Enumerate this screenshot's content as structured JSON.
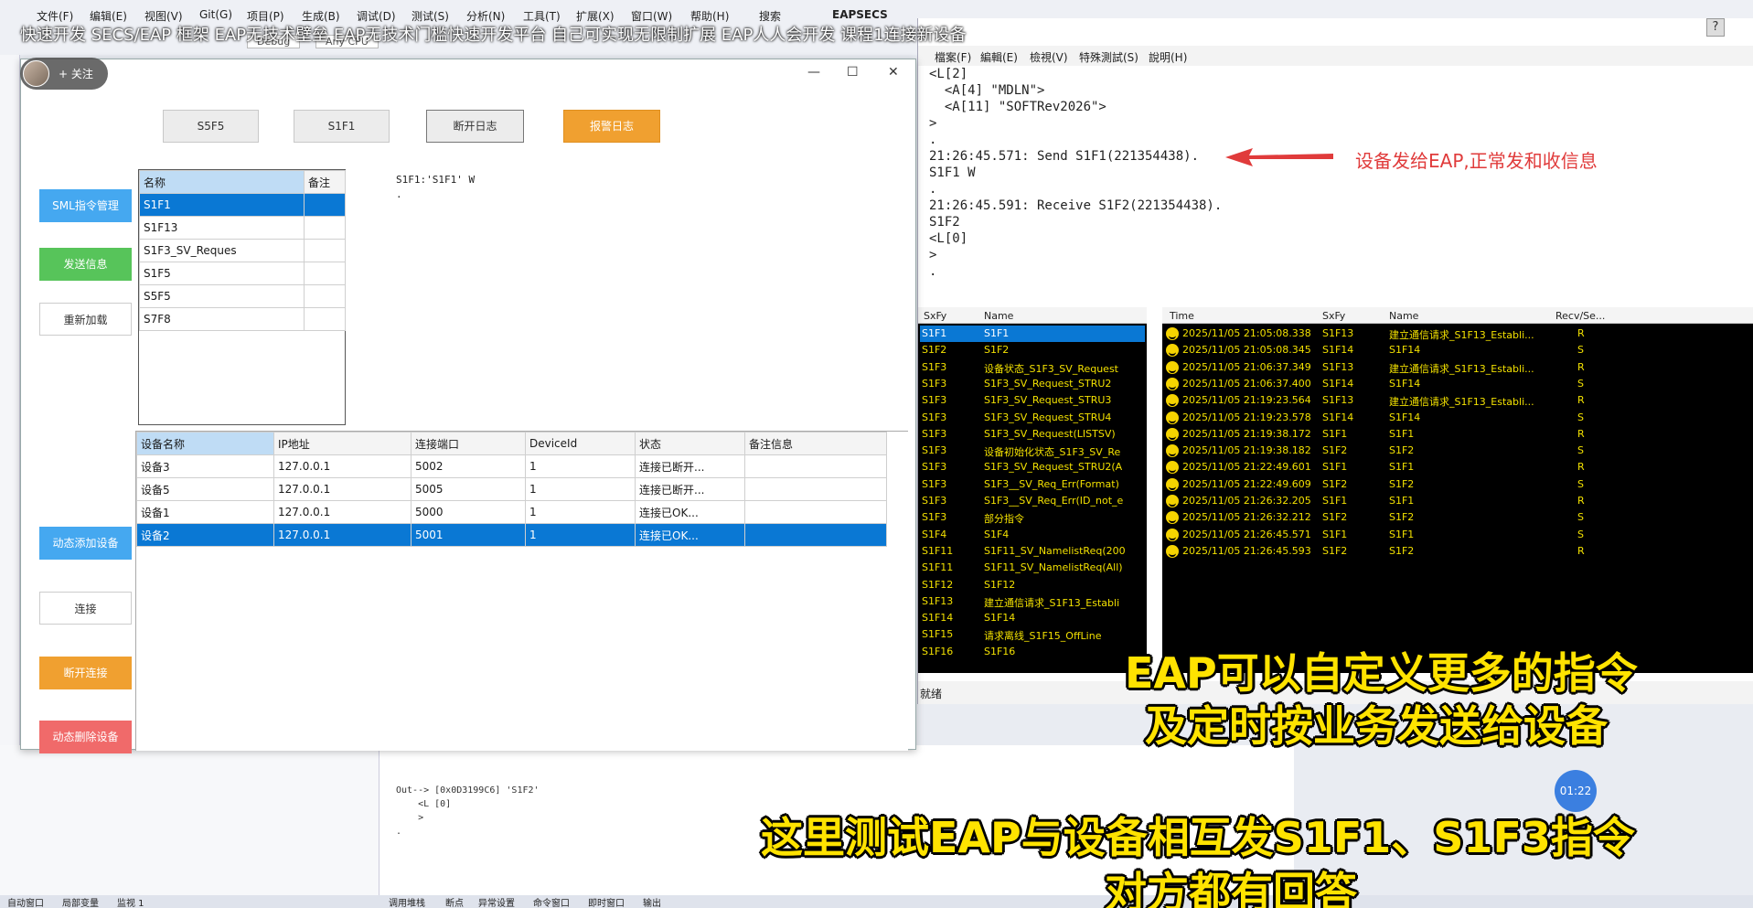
{
  "vs": {
    "menu": [
      "文件(F)",
      "编辑(E)",
      "视图(V)",
      "Git(G)",
      "项目(P)",
      "生成(B)",
      "调试(D)",
      "测试(S)",
      "分析(N)",
      "工具(T)",
      "扩展(X)",
      "窗口(W)",
      "帮助(H)"
    ],
    "search_label": "搜索",
    "app_name": "EAPSECS",
    "toolbar_debug": "Debug",
    "toolbar_cpu": "Any CPU",
    "output_lines": "Out--> [0x0D3199C6] 'S1F2'\n    <L [0]\n    >\n.",
    "status_tabs": [
      "自动窗口",
      "局部变量",
      "监视 1",
      "调用堆栈",
      "断点",
      "异常设置",
      "命令窗口",
      "即时窗口",
      "输出"
    ]
  },
  "video": {
    "title": "快速开发 SECS/EAP 框架 EAP无技术壁垒 EAP无技术门槛快速开发平台 自己可实现无限制扩展 EAP人人会开发 课程1连接新设备",
    "follow_label": "+ 关注",
    "help": "?",
    "timer": "01:22"
  },
  "eap": {
    "window_controls": [
      "—",
      "☐",
      "✕"
    ],
    "top_buttons": [
      {
        "label": "S5F5",
        "color": "#ececec"
      },
      {
        "label": "S1F1",
        "color": "#ececec"
      },
      {
        "label": "断开日志",
        "color": "#ececec"
      },
      {
        "label": "报警日志",
        "color": "#f0a030"
      }
    ],
    "side_buttons": [
      {
        "label": "SML指令管理",
        "color": "#45a8f0"
      },
      {
        "label": "发送信息",
        "color": "#57c45a"
      },
      {
        "label": "重新加载",
        "color": "#ffffff"
      },
      {
        "label": "动态添加设备",
        "color": "#45a8f0"
      },
      {
        "label": "连接",
        "color": "#ffffff"
      },
      {
        "label": "断开连接",
        "color": "#f0a030"
      },
      {
        "label": "动态删除设备",
        "color": "#f06a6a"
      }
    ],
    "cmd_grid": {
      "headers": [
        "名称",
        "备注"
      ],
      "rows": [
        {
          "name": "S1F1",
          "note": ""
        },
        {
          "name": "S1F13",
          "note": ""
        },
        {
          "name": "S1F3_SV_Reques",
          "note": ""
        },
        {
          "name": "S1F5",
          "note": ""
        },
        {
          "name": "S5F5",
          "note": ""
        },
        {
          "name": "S7F8",
          "note": ""
        }
      ]
    },
    "cmd_text": "S1F1:'S1F1' W\n.",
    "device_grid": {
      "headers": [
        "设备名称",
        "IP地址",
        "连接端口",
        "DeviceId",
        "状态",
        "备注信息"
      ],
      "rows": [
        {
          "name": "设备3",
          "ip": "127.0.0.1",
          "port": "5002",
          "id": "1",
          "status": "连接已断开...",
          "note": ""
        },
        {
          "name": "设备5",
          "ip": "127.0.0.1",
          "port": "5005",
          "id": "1",
          "status": "连接已断开...",
          "note": ""
        },
        {
          "name": "设备1",
          "ip": "127.0.0.1",
          "port": "5000",
          "id": "1",
          "status": "连接已OK...",
          "note": ""
        },
        {
          "name": "设备2",
          "ip": "127.0.0.1",
          "port": "5001",
          "id": "1",
          "status": "连接已OK...",
          "note": ""
        }
      ]
    }
  },
  "secs": {
    "menu": [
      "檔案(F)",
      "編輯(E)",
      "檢視(V)",
      "特殊測試(S)",
      "說明(H)"
    ],
    "log_text": "<L[2]\n  <A[4] \"MDLN\">\n  <A[11] \"SOFTRev2026\">\n>\n.\n21:26:45.571: Send S1F1(221354438).\nS1F1 W\n.\n21:26:45.591: Receive S1F2(221354438).\nS1F2\n<L[0]\n>\n.",
    "msg_headers": [
      "SxFy",
      "Name"
    ],
    "messages": [
      {
        "sxfy": "S1F1",
        "name": "S1F1"
      },
      {
        "sxfy": "S1F2",
        "name": "S1F2"
      },
      {
        "sxfy": "S1F3",
        "name": "设备状态_S1F3_SV_Request"
      },
      {
        "sxfy": "S1F3",
        "name": "S1F3_SV_Request_STRU2"
      },
      {
        "sxfy": "S1F3",
        "name": "S1F3_SV_Request_STRU3"
      },
      {
        "sxfy": "S1F3",
        "name": "S1F3_SV_Request_STRU4"
      },
      {
        "sxfy": "S1F3",
        "name": "S1F3_SV_Request(LISTSV)"
      },
      {
        "sxfy": "S1F3",
        "name": "设备初始化状态_S1F3_SV_Re"
      },
      {
        "sxfy": "S1F3",
        "name": "S1F3_SV_Request_STRU2(A"
      },
      {
        "sxfy": "S1F3",
        "name": "S1F3__SV_Req_Err(Format)"
      },
      {
        "sxfy": "S1F3",
        "name": "S1F3__SV_Req_Err(ID_not_e"
      },
      {
        "sxfy": "S1F3",
        "name": "部分指令"
      },
      {
        "sxfy": "S1F4",
        "name": "S1F4"
      },
      {
        "sxfy": "S1F11",
        "name": "S1F11_SV_NamelistReq(200"
      },
      {
        "sxfy": "S1F11",
        "name": "S1F11_SV_NamelistReq(All)"
      },
      {
        "sxfy": "S1F12",
        "name": "S1F12"
      },
      {
        "sxfy": "S1F13",
        "name": "建立通信请求_S1F13_Establi"
      },
      {
        "sxfy": "S1F14",
        "name": "S1F14"
      },
      {
        "sxfy": "S1F15",
        "name": "请求离线_S1F15_OffLine"
      },
      {
        "sxfy": "S1F16",
        "name": "S1F16"
      }
    ],
    "log_headers": [
      "Time",
      "SxFy",
      "Name",
      "Recv/Se..."
    ],
    "logs": [
      {
        "time": "2025/11/05 21:05:08.338",
        "sxfy": "S1F13",
        "name": "建立通信请求_S1F13_Establi...",
        "rs": "R"
      },
      {
        "time": "2025/11/05 21:05:08.345",
        "sxfy": "S1F14",
        "name": "S1F14",
        "rs": "S"
      },
      {
        "time": "2025/11/05 21:06:37.349",
        "sxfy": "S1F13",
        "name": "建立通信请求_S1F13_Establi...",
        "rs": "R"
      },
      {
        "time": "2025/11/05 21:06:37.400",
        "sxfy": "S1F14",
        "name": "S1F14",
        "rs": "S"
      },
      {
        "time": "2025/11/05 21:19:23.564",
        "sxfy": "S1F13",
        "name": "建立通信请求_S1F13_Establi...",
        "rs": "R"
      },
      {
        "time": "2025/11/05 21:19:23.578",
        "sxfy": "S1F14",
        "name": "S1F14",
        "rs": "S"
      },
      {
        "time": "2025/11/05 21:19:38.172",
        "sxfy": "S1F1",
        "name": "S1F1",
        "rs": "R"
      },
      {
        "time": "2025/11/05 21:19:38.182",
        "sxfy": "S1F2",
        "name": "S1F2",
        "rs": "S"
      },
      {
        "time": "2025/11/05 21:22:49.601",
        "sxfy": "S1F1",
        "name": "S1F1",
        "rs": "R"
      },
      {
        "time": "2025/11/05 21:22:49.609",
        "sxfy": "S1F2",
        "name": "S1F2",
        "rs": "S"
      },
      {
        "time": "2025/11/05 21:26:32.205",
        "sxfy": "S1F1",
        "name": "S1F1",
        "rs": "R"
      },
      {
        "time": "2025/11/05 21:26:32.212",
        "sxfy": "S1F2",
        "name": "S1F2",
        "rs": "S"
      },
      {
        "time": "2025/11/05 21:26:45.571",
        "sxfy": "S1F1",
        "name": "S1F1",
        "rs": "S"
      },
      {
        "time": "2025/11/05 21:26:45.593",
        "sxfy": "S1F2",
        "name": "S1F2",
        "rs": "R"
      }
    ],
    "status": "就绪"
  },
  "annotations": {
    "red_note": "设备发给EAP,正常发和收信息",
    "caption1_line1": "EAP可以自定义更多的指令",
    "caption1_line2": "及定时按业务发送给设备",
    "caption2_line1": "这里测试EAP与设备相互发S1F1、S1F3指令",
    "caption2_line2": "对方都有回答"
  }
}
